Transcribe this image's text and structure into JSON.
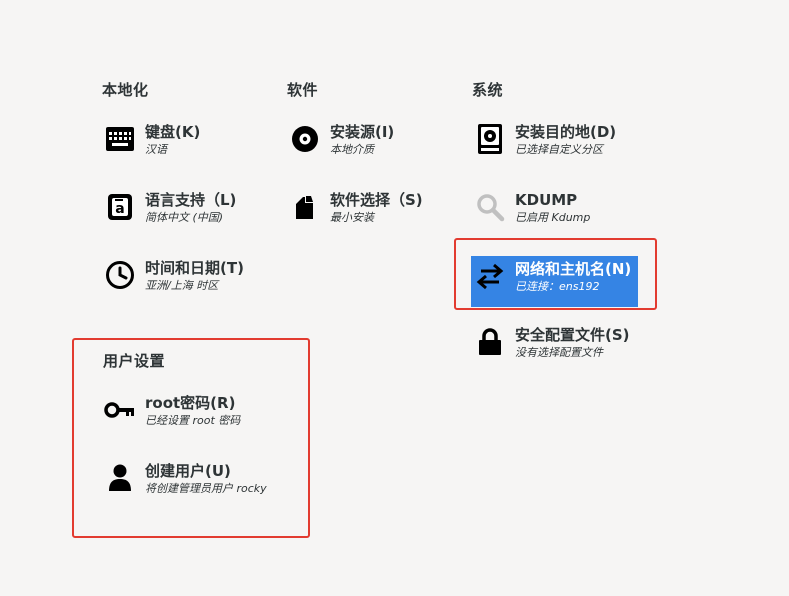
{
  "sections": {
    "localization": "本地化",
    "software": "软件",
    "system": "系统",
    "user_settings": "用户设置"
  },
  "spokes": {
    "keyboard": {
      "title": "键盘(K)",
      "status": "汉语",
      "icon": "keyboard-icon"
    },
    "language": {
      "title": "语言支持（L)",
      "status": "简体中文 (中国)",
      "icon": "language-icon"
    },
    "time_date": {
      "title": "时间和日期(T)",
      "status": "亚洲/上海 时区",
      "icon": "clock-icon"
    },
    "install_source": {
      "title": "安装源(I)",
      "status": "本地介质",
      "icon": "disc-icon"
    },
    "software_selection": {
      "title": "软件选择（S)",
      "status": "最小安装",
      "icon": "package-icon"
    },
    "install_destination": {
      "title": "安装目的地(D)",
      "status": "已选择自定义分区",
      "icon": "hard-drive-icon"
    },
    "kdump": {
      "title": "KDUMP",
      "status": "已启用 Kdump",
      "icon": "magnifier-icon"
    },
    "network": {
      "title": "网络和主机名(N)",
      "status": "已连接：ens192",
      "icon": "network-arrows-icon"
    },
    "security": {
      "title": "安全配置文件(S)",
      "status": "没有选择配置文件",
      "icon": "lock-icon"
    },
    "root_password": {
      "title": "root密码(R)",
      "status": "已经设置 root 密码",
      "icon": "key-icon"
    },
    "create_user": {
      "title": "创建用户(U)",
      "status": "将创建管理员用户 rocky",
      "icon": "user-icon"
    }
  },
  "colors": {
    "background": "#f6f5f4",
    "selected": "#3584e4",
    "highlight_box": "#e23b30",
    "text": "#2e3436"
  }
}
